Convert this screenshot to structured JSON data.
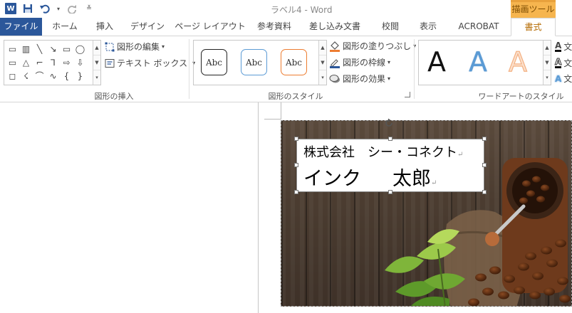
{
  "window": {
    "title": "ラベル4 - Word",
    "contextual_header": "描画ツール"
  },
  "tabs": [
    {
      "label": "ファイル",
      "state": "file"
    },
    {
      "label": "ホーム"
    },
    {
      "label": "挿入"
    },
    {
      "label": "デザイン"
    },
    {
      "label": "ページ レイアウト"
    },
    {
      "label": "参考資料"
    },
    {
      "label": "差し込み文書"
    },
    {
      "label": "校閲"
    },
    {
      "label": "表示"
    },
    {
      "label": "ACROBAT"
    },
    {
      "label": "書式",
      "state": "active"
    }
  ],
  "ribbon": {
    "insert_shapes": {
      "label": "図形の挿入",
      "edit_shape": "図形の編集",
      "text_box": "テキスト ボックス",
      "shape_glyphs": [
        "▭",
        "▥",
        "╲",
        "↘",
        "▭",
        "◯",
        "▭",
        "△",
        "⌐",
        "⅂",
        "⇨",
        "⇩",
        "◻",
        "☇",
        "⌒",
        "∿",
        "{",
        "}"
      ]
    },
    "shape_styles": {
      "label": "図形のスタイル",
      "preset_text": "Abc",
      "fill": "図形の塗りつぶし",
      "outline": "図形の枠線",
      "effects": "図形の効果"
    },
    "wordart": {
      "label": "ワードアートのスタイル",
      "letter": "A",
      "text_fill_label": "文",
      "text_outline_label": "文",
      "text_effects_label": "文"
    }
  },
  "document": {
    "textbox": {
      "line1": "株式会社　シー・コネクト",
      "line2_left": "インク",
      "line2_right": "太郎"
    }
  },
  "colors": {
    "file_tab": "#2b579a",
    "contextual_tab": "#f6b54f",
    "wordart_black": "#111111",
    "wordart_blue": "#5b9bd5",
    "wordart_orange": "#f4b183"
  }
}
